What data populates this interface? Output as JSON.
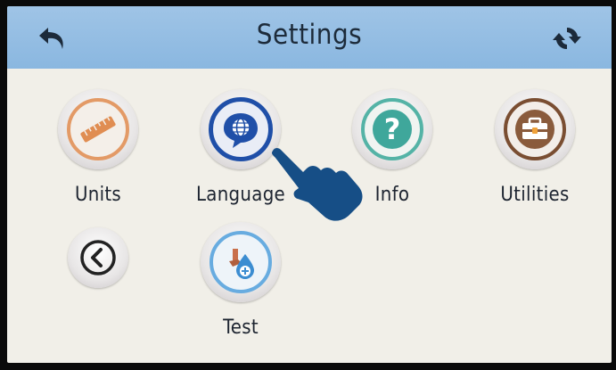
{
  "header": {
    "title": "Settings",
    "back_icon": "undo-arrow-icon",
    "refresh_icon": "refresh-icon",
    "bar_color": "#8ab7e0"
  },
  "menu": {
    "items": [
      {
        "label": "Units",
        "icon": "ruler-icon",
        "accent": "#e08d52"
      },
      {
        "label": "Language",
        "icon": "globe-speech-bubble-icon",
        "accent": "#1f4fa8"
      },
      {
        "label": "Info",
        "icon": "question-mark-icon",
        "accent": "#3fa79b"
      },
      {
        "label": "Utilities",
        "icon": "toolbox-icon",
        "accent": "#8a5b3c"
      },
      {
        "label": "",
        "icon": "previous-page-icon",
        "accent": "#222222"
      },
      {
        "label": "Test",
        "icon": "blood-drop-test-icon",
        "accent": "#3c8dd1"
      }
    ]
  },
  "overlay": {
    "icon": "pointing-hand-icon",
    "color": "#164e86"
  }
}
